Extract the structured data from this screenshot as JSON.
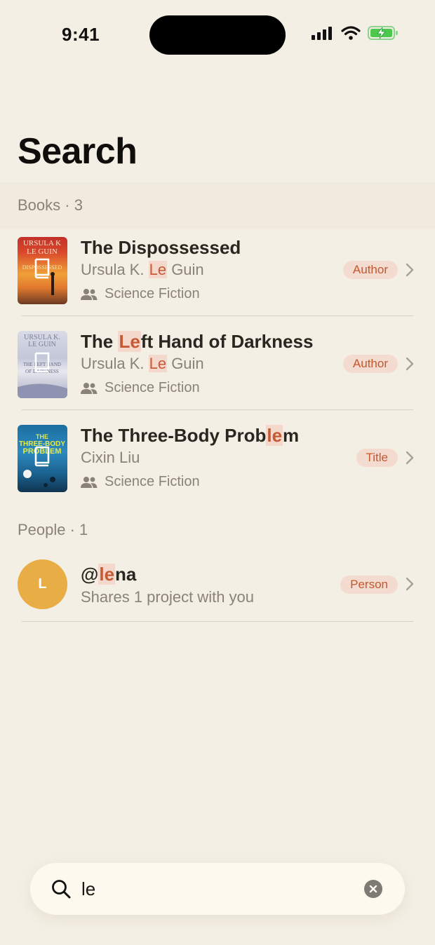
{
  "status": {
    "time": "9:41"
  },
  "page": {
    "title": "Search"
  },
  "sections": {
    "books": {
      "label": "Books · 3"
    },
    "people": {
      "label": "People · 1"
    }
  },
  "books": [
    {
      "title_parts": [
        "The Dispossessed",
        "",
        ""
      ],
      "author_parts": [
        "Ursula K. ",
        "Le",
        " Guin"
      ],
      "genre": "Science Fiction",
      "badge": "Author"
    },
    {
      "title_parts": [
        "The ",
        "Le",
        "ft Hand of Darkness"
      ],
      "author_parts": [
        "Ursula K. ",
        "Le",
        " Guin"
      ],
      "genre": "Science Fiction",
      "badge": "Author"
    },
    {
      "title_parts": [
        "The Three-Body Prob",
        "le",
        "m"
      ],
      "author": "Cixin Liu",
      "genre": "Science Fiction",
      "badge": "Title"
    }
  ],
  "people": [
    {
      "avatar_initial": "L",
      "handle_parts": [
        "@",
        "le",
        "na"
      ],
      "subtitle": "Shares 1 project with you",
      "badge": "Person"
    }
  ],
  "search": {
    "query": "le"
  },
  "colors": {
    "accent": "#C4572F",
    "highlight_bg": "#F4D8CB",
    "background": "#F4EFE4",
    "avatar": "#E8AE45"
  }
}
